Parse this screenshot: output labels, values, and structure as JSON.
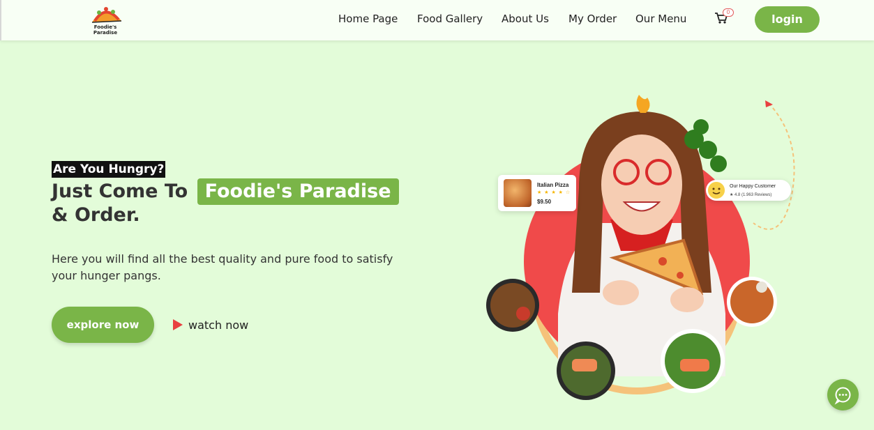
{
  "brand": {
    "logo_text": "Foodie's Paradise"
  },
  "nav": {
    "links": [
      "Home Page",
      "Food Gallery",
      "About Us",
      "My Order",
      "Our Menu"
    ],
    "cart_count": "0",
    "login_label": "login"
  },
  "hero": {
    "eyebrow": "Are You Hungry?",
    "headline_prefix": "Just Come To",
    "headline_brand": "Foodie's Paradise",
    "headline_suffix": "& Order.",
    "description": "Here you will find all the best quality and pure food to satisfy your hunger pangs.",
    "explore_label": "explore now",
    "watch_label": "watch now"
  },
  "promo_card": {
    "title": "Italian Pizza",
    "stars": "★ ★ ★ ★ ☆",
    "price": "$9.50"
  },
  "customer_card": {
    "title": "Our Happy Customer",
    "rating": "★ 4.8 (1.963 Reviews)"
  },
  "colors": {
    "accent": "#7ab548",
    "background": "#e3fcd9",
    "circle": "#f04a4a",
    "ring": "#f5c27a"
  },
  "icons": [
    "cart-icon",
    "play-icon",
    "chat-icon",
    "fire-icon",
    "smiley-icon",
    "star-icon"
  ]
}
